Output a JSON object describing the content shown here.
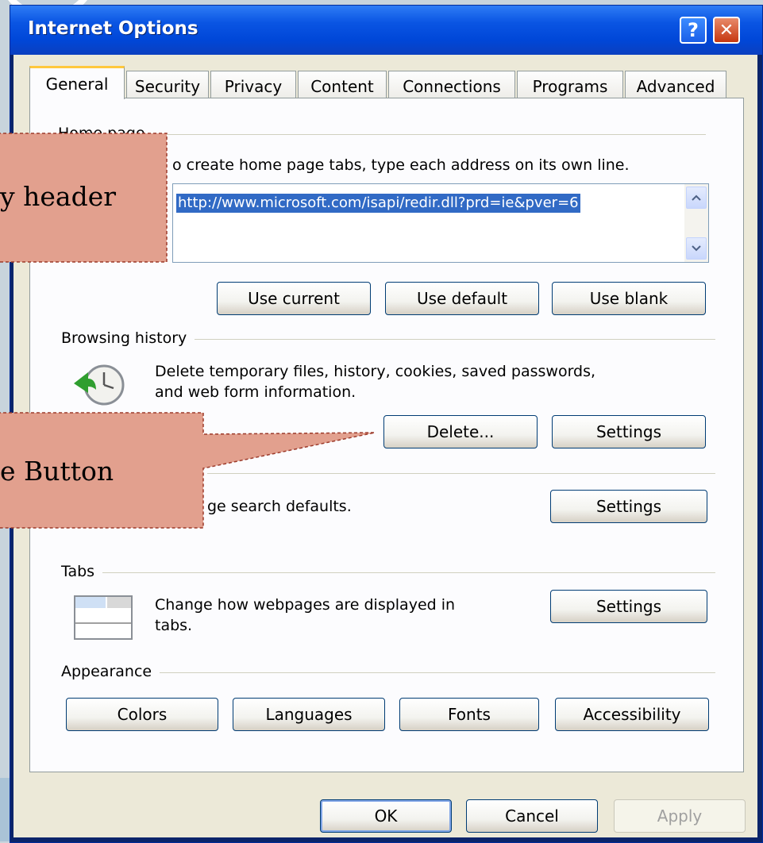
{
  "window": {
    "title": "Internet Options",
    "help_glyph": "?",
    "close_glyph": "✕"
  },
  "tabs": [
    {
      "label": "General"
    },
    {
      "label": "Security"
    },
    {
      "label": "Privacy"
    },
    {
      "label": "Content"
    },
    {
      "label": "Connections"
    },
    {
      "label": "Programs"
    },
    {
      "label": "Advanced"
    }
  ],
  "home_page": {
    "group_label": "Home page",
    "instruction": "o create home page tabs, type each address on its own line.",
    "url_value": "http://www.microsoft.com/isapi/redir.dll?prd=ie&pver=6",
    "buttons": {
      "use_current": "Use current",
      "use_default": "Use default",
      "use_blank": "Use blank"
    }
  },
  "browsing_history": {
    "group_label": "Browsing history",
    "description_line1": "Delete temporary files, history, cookies, saved passwords,",
    "description_line2": "and web form information.",
    "buttons": {
      "delete": "Delete...",
      "settings": "Settings"
    }
  },
  "search": {
    "description": "ge search defaults.",
    "settings": "Settings"
  },
  "tabs_section": {
    "group_label": "Tabs",
    "description_line1": "Change how webpages are displayed in",
    "description_line2": "tabs.",
    "settings": "Settings"
  },
  "appearance": {
    "group_label": "Appearance",
    "buttons": {
      "colors": "Colors",
      "languages": "Languages",
      "fonts": "Fonts",
      "accessibility": "Accessibility"
    }
  },
  "footer": {
    "ok": "OK",
    "cancel": "Cancel",
    "apply": "Apply"
  },
  "callouts": {
    "history_header": "y header",
    "delete_button": "e Button"
  },
  "colors": {
    "callout_fill": "#e2a08e",
    "callout_border": "#9c3a2a",
    "titlebar": "#0a55e3"
  }
}
